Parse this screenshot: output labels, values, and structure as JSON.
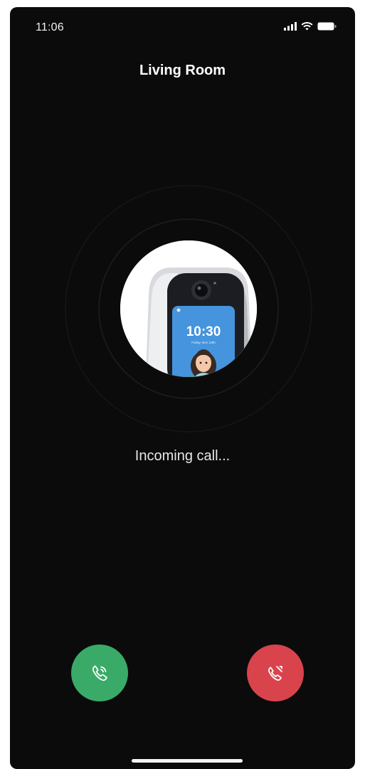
{
  "status_bar": {
    "time": "11:06",
    "icons": [
      "signal-icon",
      "wifi-icon",
      "battery-icon"
    ]
  },
  "header": {
    "title": "Living Room"
  },
  "device_preview": {
    "screen_time": "10:30",
    "screen_date": "Friday, Nov. 24th"
  },
  "call": {
    "status": "Incoming call..."
  },
  "actions": {
    "accept_icon": "phone-icon",
    "decline_icon": "phone-hangup-icon"
  },
  "colors": {
    "background": "#0b0b0c",
    "accept": "#3aaa68",
    "decline": "#d9444c"
  }
}
